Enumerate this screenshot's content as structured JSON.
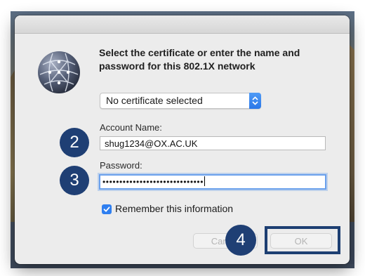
{
  "dialog": {
    "prompt_line1": "Select the certificate or enter the name and",
    "prompt_line2": "password for this 802.1X network",
    "certificate_select": {
      "value": "No certificate selected"
    },
    "account": {
      "label": "Account Name:",
      "value": "shug1234@OX.AC.UK"
    },
    "password": {
      "label": "Password:",
      "masked_value": "••••••••••••••••••••••••••••••"
    },
    "remember": {
      "label": "Remember this information",
      "checked": true
    },
    "buttons": {
      "cancel": "Cancel",
      "ok": "OK"
    }
  },
  "annotations": {
    "step2": "2",
    "step3": "3",
    "step4": "4"
  },
  "colors": {
    "accent": "#2f7ff0",
    "badge": "#1f3f74",
    "focus": "#6aa0ec"
  },
  "icons": [
    "network-globe-icon",
    "select-arrows-icon",
    "checkmark-icon"
  ]
}
